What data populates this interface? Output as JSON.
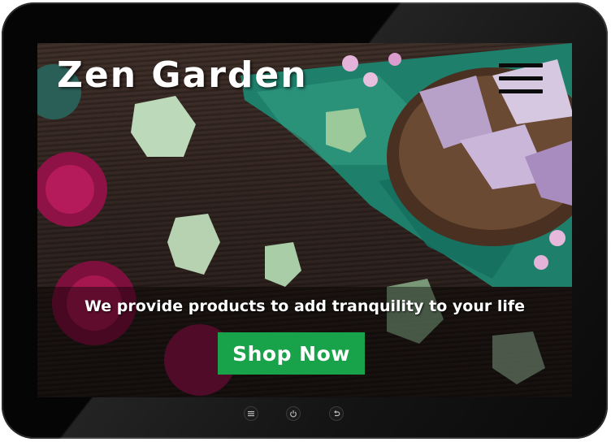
{
  "site": {
    "title": "Zen Garden",
    "tagline": "We provide products to add tranquility to your life",
    "cta_label": "Shop Now"
  },
  "menu": {
    "icon": "hamburger-menu-icon"
  },
  "device_buttons": [
    {
      "icon": "menu-list-icon"
    },
    {
      "icon": "power-icon"
    },
    {
      "icon": "back-arrow-icon"
    }
  ],
  "colors": {
    "cta_background": "#18a34a",
    "text": "#ffffff",
    "device_bezel": "#050505"
  }
}
